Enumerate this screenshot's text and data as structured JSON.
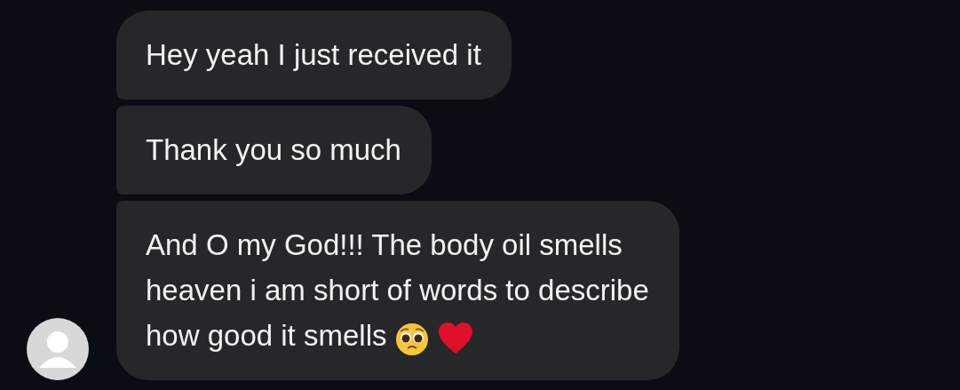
{
  "messages": [
    {
      "lines": [
        "Hey yeah I just received it"
      ]
    },
    {
      "lines": [
        "Thank you so much"
      ]
    },
    {
      "lines": [
        "And O my God!!! The body oil smells",
        "heaven i am short of words to describe",
        "how good it smells"
      ],
      "icons": [
        {
          "kind": "pleading"
        },
        {
          "kind": "heart"
        }
      ],
      "avatar": true
    }
  ]
}
